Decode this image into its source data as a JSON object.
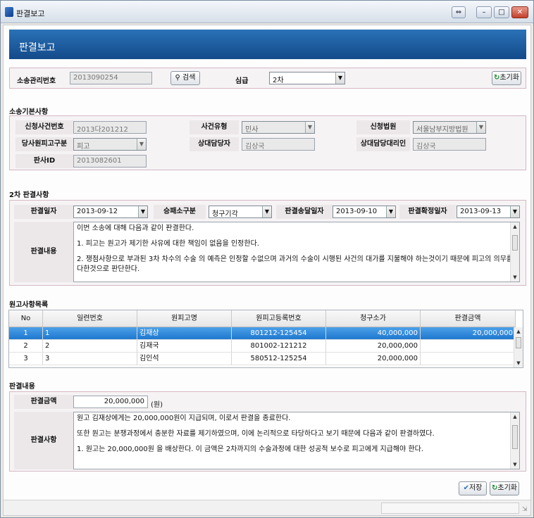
{
  "window": {
    "title": "판결보고",
    "btn_restore": "⇔",
    "btn_min": "–",
    "btn_max": "□",
    "btn_close": "✕"
  },
  "header": {
    "title": "판결보고"
  },
  "search": {
    "case_mgmt_label": "소송관리번호",
    "case_mgmt_value": "2013090254",
    "search_button": "검색",
    "instance_label": "심급",
    "instance_value": "2차",
    "reset_button": "초기화"
  },
  "basic": {
    "section_title": "소송기본사항",
    "app_case_no_label": "신청사건번호",
    "app_case_no": "2013다201212",
    "case_type_label": "사건유형",
    "case_type": "민사",
    "court_label": "신청법원",
    "court": "서울남부지방법원",
    "party_label": "당사원피고구분",
    "party": "피고",
    "opp_manager_label": "상대담당자",
    "opp_manager": "김상국",
    "opp_agent_label": "상대담당대리인",
    "opp_agent": "김상국",
    "pan_id_label": "판사ID",
    "pan_id": "2013082601"
  },
  "judgment": {
    "section_title": "2차 판결사항",
    "date_label": "판결일자",
    "date": "2013-09-12",
    "result_label": "승패소구분",
    "result": "청구기각",
    "delivery_label": "판결송달일자",
    "delivery": "2013-09-10",
    "final_label": "판결확정일자",
    "final": "2013-09-13",
    "content_label": "판결내용",
    "content_lines": [
      "이번 소송에 대해 다음과 같이 판결한다.",
      "1. 피고는 원고가 제기한 사유에 대한 책임이 없음을 인정한다.",
      "2. 쟁점사항으로 부과된 3차 차수의 수술 의 예측은 인정할 수없으며 과거의 수술이 시행된 사건의 대가를 지불해야 하는것이기 때문에 피고의 의무를",
      "다한것으로 판단한다."
    ]
  },
  "plaintiffs": {
    "section_title": "원고사항목록",
    "columns": [
      "No",
      "일련번호",
      "원피고명",
      "원피고등록번호",
      "청구소가",
      "판결금액"
    ],
    "rows": [
      {
        "no": "1",
        "seq": "1",
        "name": "김재상",
        "reg": "801212-125454",
        "claim": "40,000,000",
        "amount": "20,000,000"
      },
      {
        "no": "2",
        "seq": "2",
        "name": "김재국",
        "reg": "801002-121212",
        "claim": "20,000,000",
        "amount": ""
      },
      {
        "no": "3",
        "seq": "3",
        "name": "김인석",
        "reg": "580512-125254",
        "claim": "20,000,000",
        "amount": ""
      }
    ]
  },
  "result": {
    "section_title": "판결내용",
    "amount_label": "판결금액",
    "amount": "20,000,000",
    "amount_unit": "(원)",
    "matters_label": "판결사항",
    "matters_lines": [
      "원고 김재상에게는 20,000,000원이 지급되며, 이로서 판결을 종료한다.",
      "또한 원고는 분쟁과정에서 충분한 자료를 제기하였으며, 이에 논리적으로 타당하다고 보기 때문에 다음과 같이 판결하였다.",
      "1. 원고는 20,000,000원 을 배상한다. 이 금액은 2차까지의 수술과정에 대한 성공적 보수로 피고에게 지급해야 한다."
    ]
  },
  "footer": {
    "save_button": "저장",
    "reset_button": "초기화"
  }
}
